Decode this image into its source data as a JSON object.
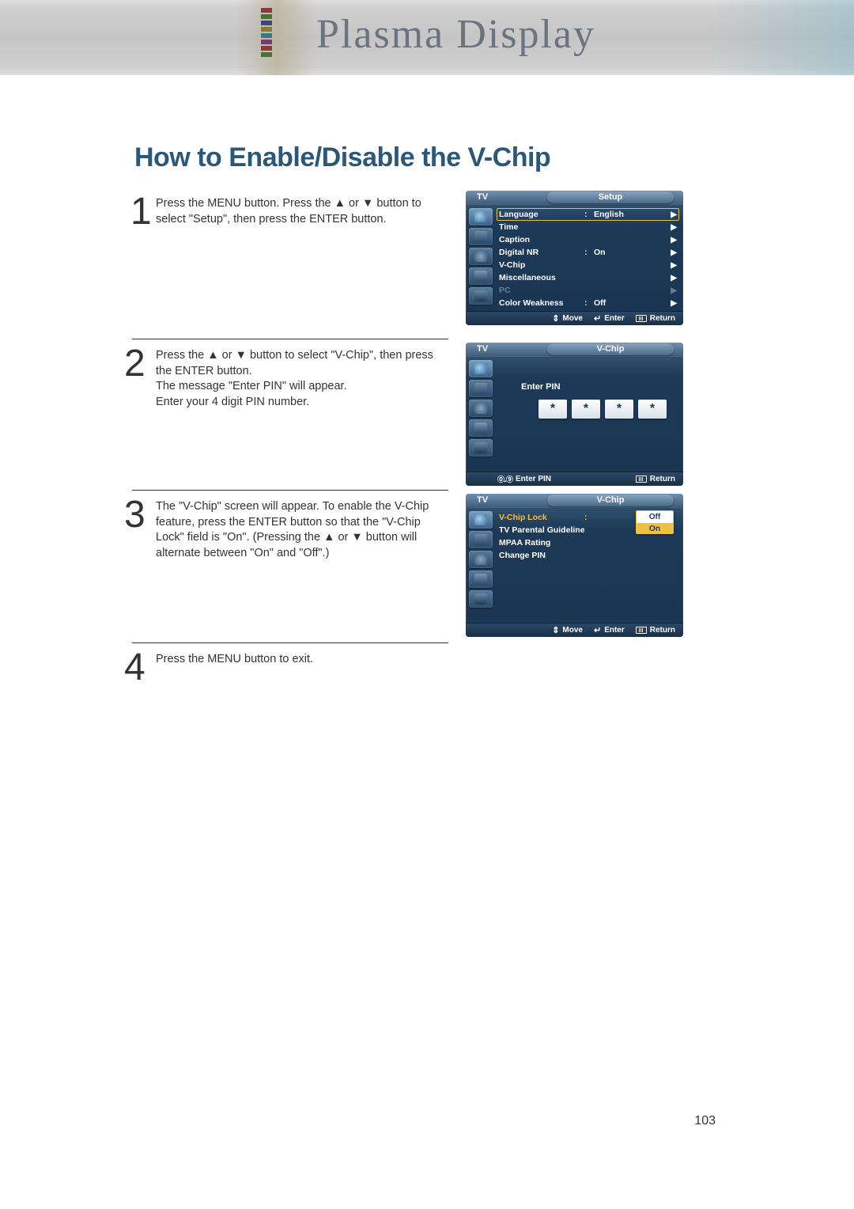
{
  "banner": {
    "title": "Plasma Display"
  },
  "page": {
    "title": "How to Enable/Disable the V-Chip",
    "number": "103"
  },
  "steps": {
    "s1": {
      "num": "1",
      "text": "Press the MENU button. Press the ▲ or ▼ button to select \"Setup\", then press the ENTER button."
    },
    "s2": {
      "num": "2",
      "l1": "Press the ▲ or ▼ button to select \"V-Chip\", then press the ENTER button.",
      "l2": "The message \"Enter PIN\" will appear.",
      "l3": "Enter your 4 digit PIN number."
    },
    "s3": {
      "num": "3",
      "text": "The \"V-Chip\" screen will appear. To enable the V-Chip feature, press the ENTER button so that the \"V-Chip Lock\" field is \"On\". (Pressing the ▲ or ▼ button will alternate between \"On\" and \"Off\".)"
    },
    "s4": {
      "num": "4",
      "text": "Press the MENU button to exit."
    }
  },
  "osd_common": {
    "tv": "TV",
    "move": "Move",
    "enter": "Enter",
    "return": "Return",
    "caret": "▶"
  },
  "osd1": {
    "title": "Setup",
    "rows": [
      {
        "label": "Language",
        "value": "English",
        "colon": ":",
        "caret": true,
        "highlight": true
      },
      {
        "label": "Time",
        "value": "",
        "colon": "",
        "caret": true
      },
      {
        "label": "Caption",
        "value": "",
        "colon": "",
        "caret": true
      },
      {
        "label": "Digital NR",
        "value": "On",
        "colon": ":",
        "caret": true
      },
      {
        "label": "V-Chip",
        "value": "",
        "colon": "",
        "caret": true
      },
      {
        "label": "Miscellaneous",
        "value": "",
        "colon": "",
        "caret": true
      },
      {
        "label": "PC",
        "value": "",
        "colon": "",
        "caret": true,
        "dim": true
      },
      {
        "label": "Color Weakness",
        "value": "Off",
        "colon": ":",
        "caret": true
      }
    ]
  },
  "osd2": {
    "title": "V-Chip",
    "prompt": "Enter PIN",
    "pin": [
      "*",
      "*",
      "*",
      "*"
    ],
    "footer_left": "Enter PIN"
  },
  "osd3": {
    "title": "V-Chip",
    "rows": [
      {
        "label": "V-Chip Lock",
        "colon": ":",
        "yellow": true
      },
      {
        "label": "TV Parental Guidelines"
      },
      {
        "label": "MPAA Rating"
      },
      {
        "label": "Change PIN"
      }
    ],
    "dropdown": {
      "off": "Off",
      "on": "On"
    }
  }
}
